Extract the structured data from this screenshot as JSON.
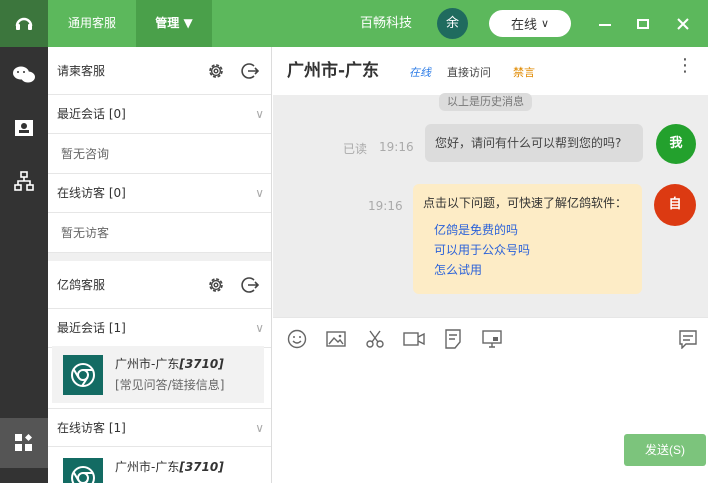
{
  "topbar": {
    "tabs": [
      "通用客服",
      "管理 ▼"
    ],
    "company": "百畅科技",
    "avatar_char": "余",
    "status": "在线",
    "status_chevron": "∨",
    "accent": "#5cb85c"
  },
  "groups": [
    {
      "name": "请柬客服",
      "recent_label": "最近会话 [0]",
      "recent_empty": "暂无咨询",
      "online_label": "在线访客 [0]",
      "online_empty": "暂无访客"
    },
    {
      "name": "亿鸽客服",
      "recent_label": "最近会话 [1]",
      "online_label": "在线访客 [1]",
      "visitor_name": "广州市-广东",
      "visitor_id": "[3710]",
      "visitor_tag": "[常见问答/链接信息]"
    }
  ],
  "chat": {
    "title": "广州市-广东",
    "status": "在线",
    "source": "直接访问",
    "ban": "禁言",
    "history_label": "以上是历史消息",
    "messages": [
      {
        "read": "已读",
        "time": "19:16",
        "text": "您好，请问有什么可以帮到您的吗?",
        "avatar": "我"
      },
      {
        "time": "19:16",
        "intro": "点击以下问题，可快速了解亿鸽软件：",
        "questions": [
          "亿鸽是免费的吗",
          "可以用于公众号吗",
          "怎么试用"
        ],
        "avatar": "自"
      }
    ],
    "send_label": "发送(S)"
  }
}
